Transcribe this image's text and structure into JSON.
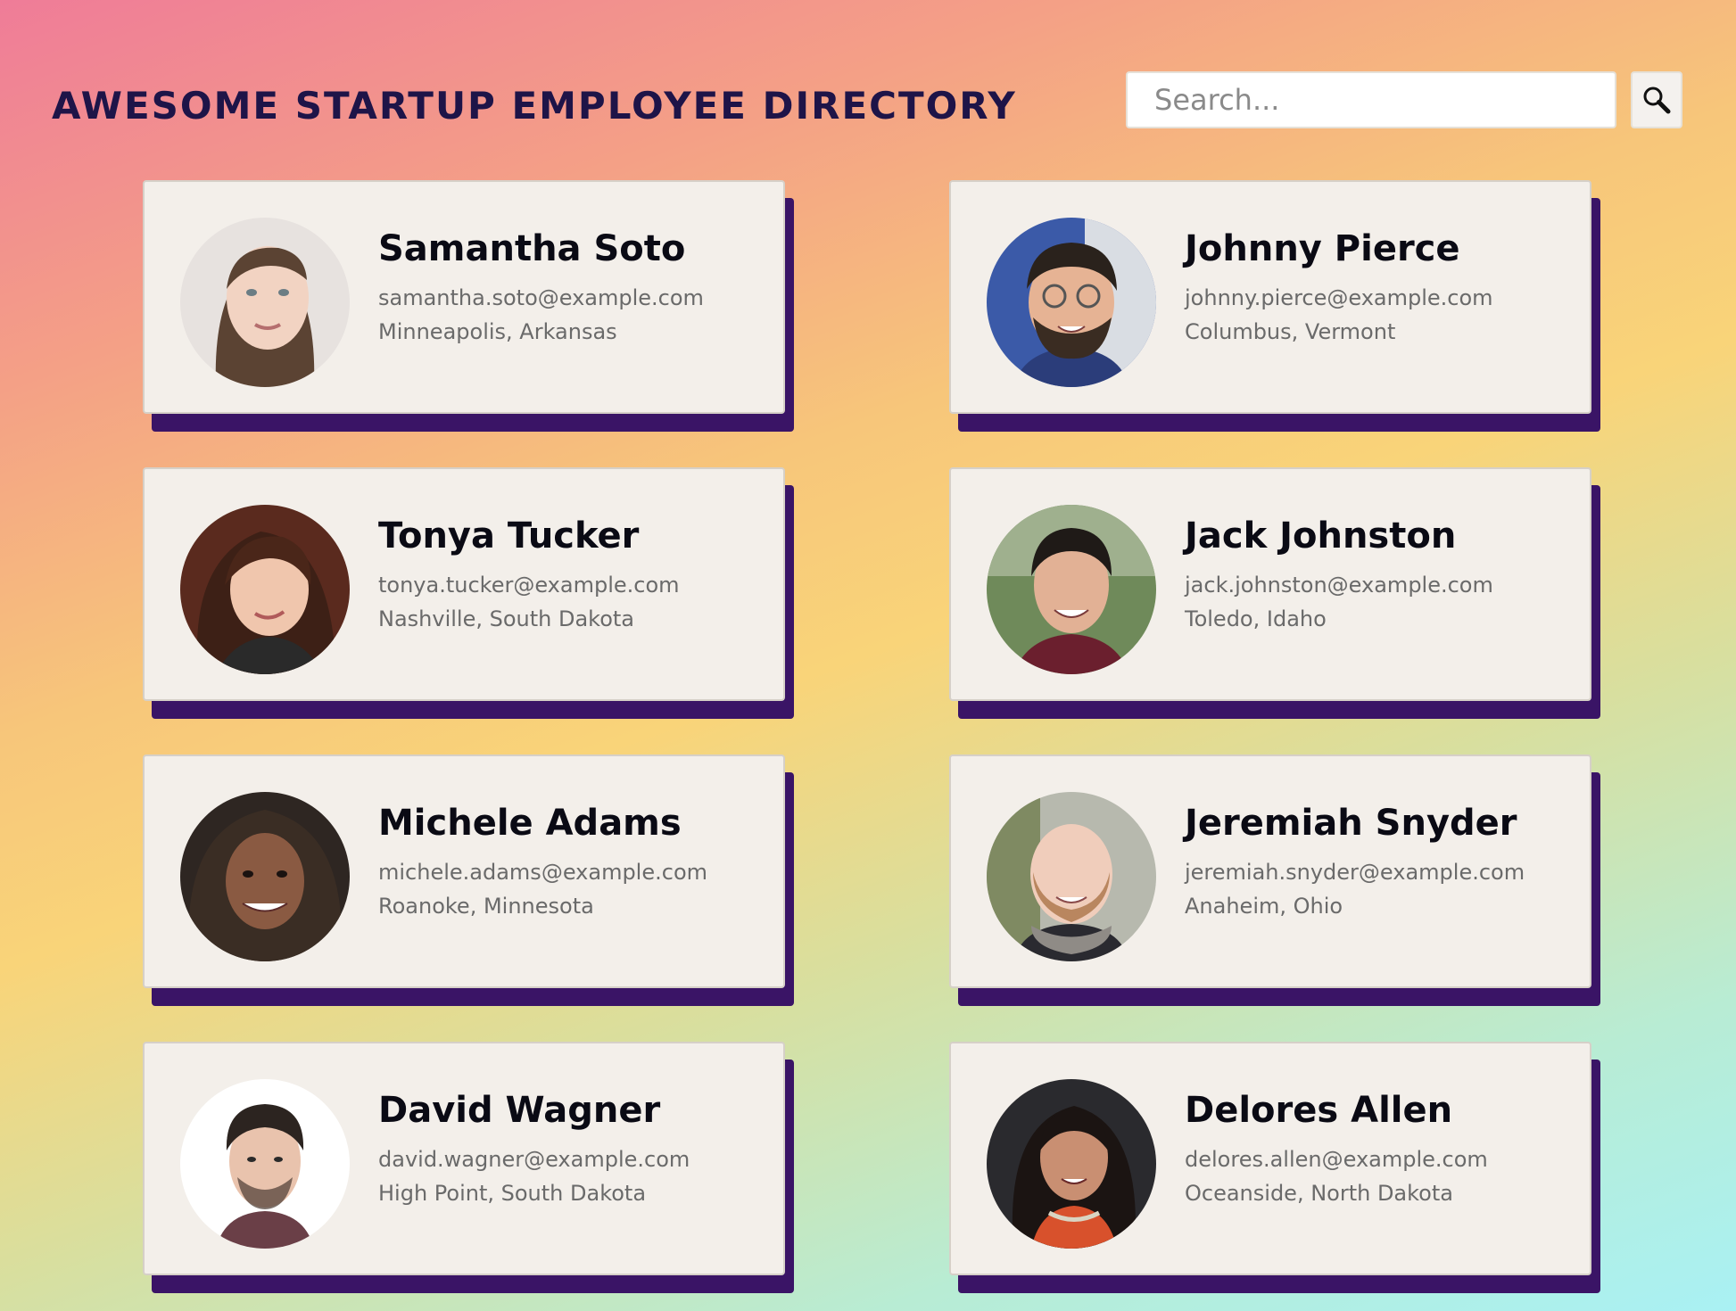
{
  "header": {
    "title": "AWESOME STARTUP EMPLOYEE DIRECTORY",
    "search_placeholder": "Search...",
    "search_button_icon": "search-icon"
  },
  "employees": [
    {
      "name": "Samantha Soto",
      "email": "samantha.soto@example.com",
      "location": "Minneapolis, Arkansas"
    },
    {
      "name": "Johnny Pierce",
      "email": "johnny.pierce@example.com",
      "location": "Columbus, Vermont"
    },
    {
      "name": "Tonya Tucker",
      "email": "tonya.tucker@example.com",
      "location": "Nashville, South Dakota"
    },
    {
      "name": "Jack Johnston",
      "email": "jack.johnston@example.com",
      "location": "Toledo, Idaho"
    },
    {
      "name": "Michele Adams",
      "email": "michele.adams@example.com",
      "location": "Roanoke, Minnesota"
    },
    {
      "name": "Jeremiah Snyder",
      "email": "jeremiah.snyder@example.com",
      "location": "Anaheim, Ohio"
    },
    {
      "name": "David Wagner",
      "email": "david.wagner@example.com",
      "location": "High Point, South Dakota"
    },
    {
      "name": "Delores Allen",
      "email": "delores.allen@example.com",
      "location": "Oceanside, North Dakota"
    }
  ],
  "colors": {
    "title": "#1e1448",
    "card_background": "#f3efea",
    "card_shadow": "#3a1466",
    "name": "#0a0a14",
    "detail_text": "#6a6a6a"
  }
}
